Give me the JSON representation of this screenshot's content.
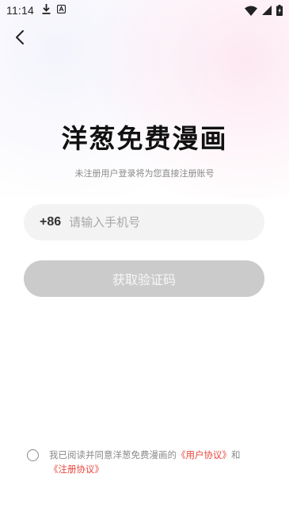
{
  "status_bar": {
    "time": "11:14",
    "icons_left": [
      "download-icon",
      "app-notification-icon"
    ],
    "icons_right": [
      "wifi-icon",
      "cellular-signal-icon",
      "battery-charging-icon"
    ]
  },
  "nav": {
    "back_icon": "back-arrow-icon"
  },
  "app": {
    "title": "洋葱免费漫画",
    "subtitle": "未注册用户登录将为您直接注册账号"
  },
  "login_form": {
    "country_code": "+86",
    "phone_placeholder": "请输入手机号",
    "phone_value": "",
    "get_code_label": "获取验证码"
  },
  "agreement": {
    "prefix": "我已阅读并同意洋葱免费漫画的",
    "user_agreement": "《用户协议》",
    "conjunction": "和",
    "register_agreement": "《注册协议》",
    "checked": false
  },
  "colors": {
    "link": "#e8473d",
    "button_disabled": "#cbcbcb",
    "input_bg": "#f3f3f3"
  }
}
